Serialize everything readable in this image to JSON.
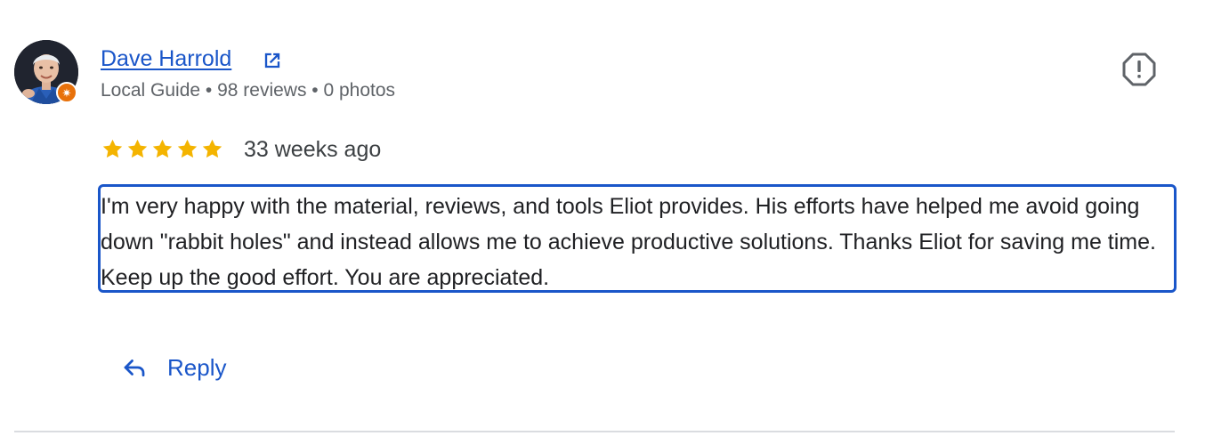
{
  "review": {
    "reviewer": {
      "name": "Dave Harrold",
      "meta": "Local Guide • 98 reviews • 0 photos",
      "badge_icon": "local-guide-star-icon",
      "link_icon": "open-in-new-icon"
    },
    "rating": {
      "stars": 5,
      "max": 5,
      "color": "#f4b400"
    },
    "date": "33 weeks ago",
    "text": "I'm very happy with the material, reviews, and tools Eliot provides. His efforts have helped me avoid going down \"rabbit holes\" and instead allows me to achieve productive solutions. Thanks Eliot for saving me time. Keep up the good effort. You are appreciated.",
    "actions": {
      "reply_label": "Reply",
      "reply_icon": "reply-arrow-icon",
      "flag_icon": "report-alert-icon"
    },
    "colors": {
      "link": "#1a56c9",
      "badge": "#e8710a",
      "secondary_text": "#5f6368"
    }
  }
}
